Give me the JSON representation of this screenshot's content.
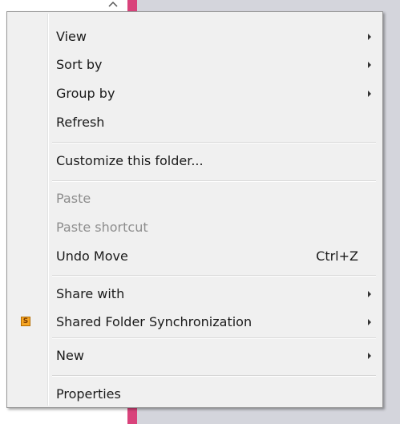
{
  "menu": {
    "items": [
      {
        "label": "View",
        "submenu": true
      },
      {
        "label": "Sort by",
        "submenu": true
      },
      {
        "label": "Group by",
        "submenu": true
      },
      {
        "label": "Refresh"
      },
      {
        "label": "Customize this folder..."
      },
      {
        "label": "Paste",
        "disabled": true
      },
      {
        "label": "Paste shortcut",
        "disabled": true
      },
      {
        "label": "Undo Move",
        "shortcut": "Ctrl+Z"
      },
      {
        "label": "Share with",
        "submenu": true
      },
      {
        "label": "Shared Folder Synchronization",
        "submenu": true,
        "icon": "shared-folder-sync-icon",
        "icon_glyph": "S"
      },
      {
        "label": "New",
        "submenu": true
      },
      {
        "label": "Properties"
      }
    ]
  },
  "colors": {
    "menu_bg": "#f0f0f0",
    "menu_border": "#979797",
    "disabled_text": "#8d8d8d",
    "accent_bar": "#d9437b",
    "background_window": "#d4d5dc"
  }
}
